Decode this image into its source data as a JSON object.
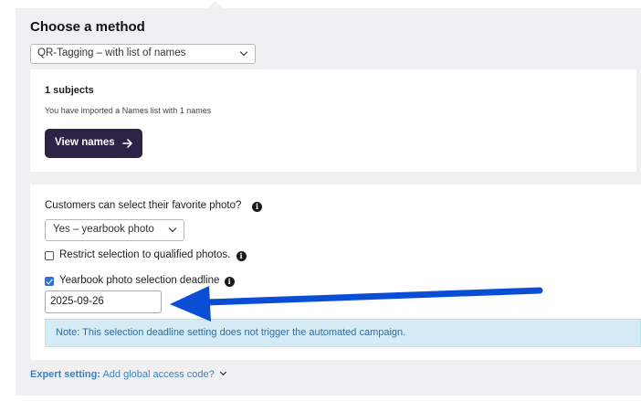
{
  "method": {
    "title": "Choose a method",
    "selected": "QR-Tagging – with list of names"
  },
  "subjects": {
    "title": "1 subjects",
    "description": "You have imported a Names list with 1 names",
    "view_button": "View names"
  },
  "favorite": {
    "label": "Customers can select their favorite photo?",
    "selected": "Yes – yearbook photo",
    "restrict_label": "Restrict selection to qualified photos.",
    "restrict_checked": false,
    "deadline_label": "Yearbook photo selection deadline",
    "deadline_checked": true,
    "deadline_value": "2025-09-26",
    "note": "Note: This selection deadline setting does not trigger the automated campaign."
  },
  "expert": {
    "label": "Expert setting:",
    "link": "Add global access code?"
  },
  "icons": {
    "info": "info-icon",
    "arrow": "arrow-right-icon",
    "chevron": "chevron-down-icon"
  },
  "colors": {
    "button_bg": "#2c2347",
    "link": "#3b82c4",
    "note_bg": "#d5ebf5",
    "checkbox": "#2f6fde",
    "annotation_arrow": "#0a4ed6"
  }
}
